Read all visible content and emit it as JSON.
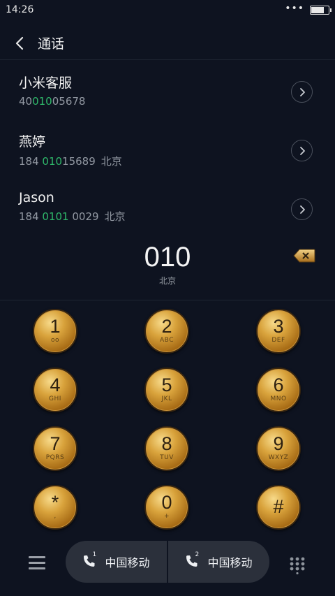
{
  "status_bar": {
    "time": "14:26",
    "dots": "•••"
  },
  "header": {
    "title": "通话"
  },
  "contacts": [
    {
      "name": "小米客服",
      "number_pre": "40",
      "number_hl": "010",
      "number_post": "05678",
      "location": ""
    },
    {
      "name": "燕婷",
      "number_pre": "184 ",
      "number_hl": "010",
      "number_post": "15689",
      "location": "北京"
    },
    {
      "name": "Jason",
      "number_pre": "184 ",
      "number_hl": "0101",
      "number_post": " 0029",
      "location": "北京"
    }
  ],
  "dialer": {
    "number": "010",
    "location": "北京"
  },
  "keys": [
    {
      "digit": "1",
      "letters": "ᴏᴏ"
    },
    {
      "digit": "2",
      "letters": "ABC"
    },
    {
      "digit": "3",
      "letters": "DEF"
    },
    {
      "digit": "4",
      "letters": "GHI"
    },
    {
      "digit": "5",
      "letters": "JKL"
    },
    {
      "digit": "6",
      "letters": "MNO"
    },
    {
      "digit": "7",
      "letters": "PQRS"
    },
    {
      "digit": "8",
      "letters": "TUV"
    },
    {
      "digit": "9",
      "letters": "WXYZ"
    },
    {
      "digit": "*",
      "letters": ","
    },
    {
      "digit": "0",
      "letters": "+"
    },
    {
      "digit": "#",
      "letters": ""
    }
  ],
  "bottom": {
    "sim1_label": "中国移动",
    "sim1_index": "1",
    "sim2_label": "中国移动",
    "sim2_index": "2"
  },
  "colors": {
    "background": "#0e1320",
    "highlight": "#2fb86a",
    "key_gold": "#d9a33c",
    "sim_bar": "#2b303b"
  },
  "icons": [
    "back-icon",
    "chevron-right-icon",
    "backspace-icon",
    "menu-icon",
    "phone-icon",
    "dialpad-icon",
    "battery-icon"
  ]
}
